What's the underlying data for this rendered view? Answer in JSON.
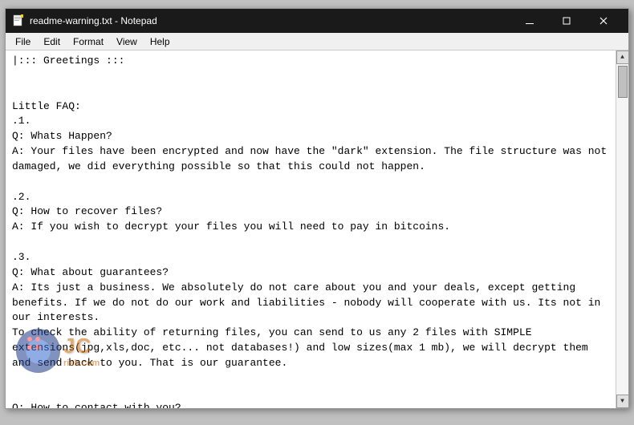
{
  "window": {
    "title": "readme-warning.txt - Notepad",
    "icon": "notepad-icon"
  },
  "titlebar": {
    "minimize_label": "minimize-button",
    "maximize_label": "maximize-button",
    "close_label": "close-button"
  },
  "menubar": {
    "items": [
      "File",
      "Edit",
      "Format",
      "View",
      "Help"
    ]
  },
  "content": {
    "text": "|::: Greetings :::\n\n\nLittle FAQ:\n.1.\nQ: Whats Happen?\nA: Your files have been encrypted and now have the \"dark\" extension. The file structure was not damaged, we did everything possible so that this could not happen.\n\n.2.\nQ: How to recover files?\nA: If you wish to decrypt your files you will need to pay in bitcoins.\n\n.3.\nQ: What about guarantees?\nA: Its just a business. We absolutely do not care about you and your deals, except getting benefits. If we do not do our work and liabilities - nobody will cooperate with us. Its not in our interests.\nTo check the ability of returning files, you can send to us any 2 files with SIMPLE extensions(jpg,xls,doc, etc... not databases!) and low sizes(max 1 mb), we will decrypt them and send back to you. That is our guarantee.\n\n\nQ: How to contact with you?\nA: You can write us to our mailbox: revilsupport@privatemail.com"
  },
  "watermark": {
    "text": "JC",
    "domain": "risk.com"
  }
}
